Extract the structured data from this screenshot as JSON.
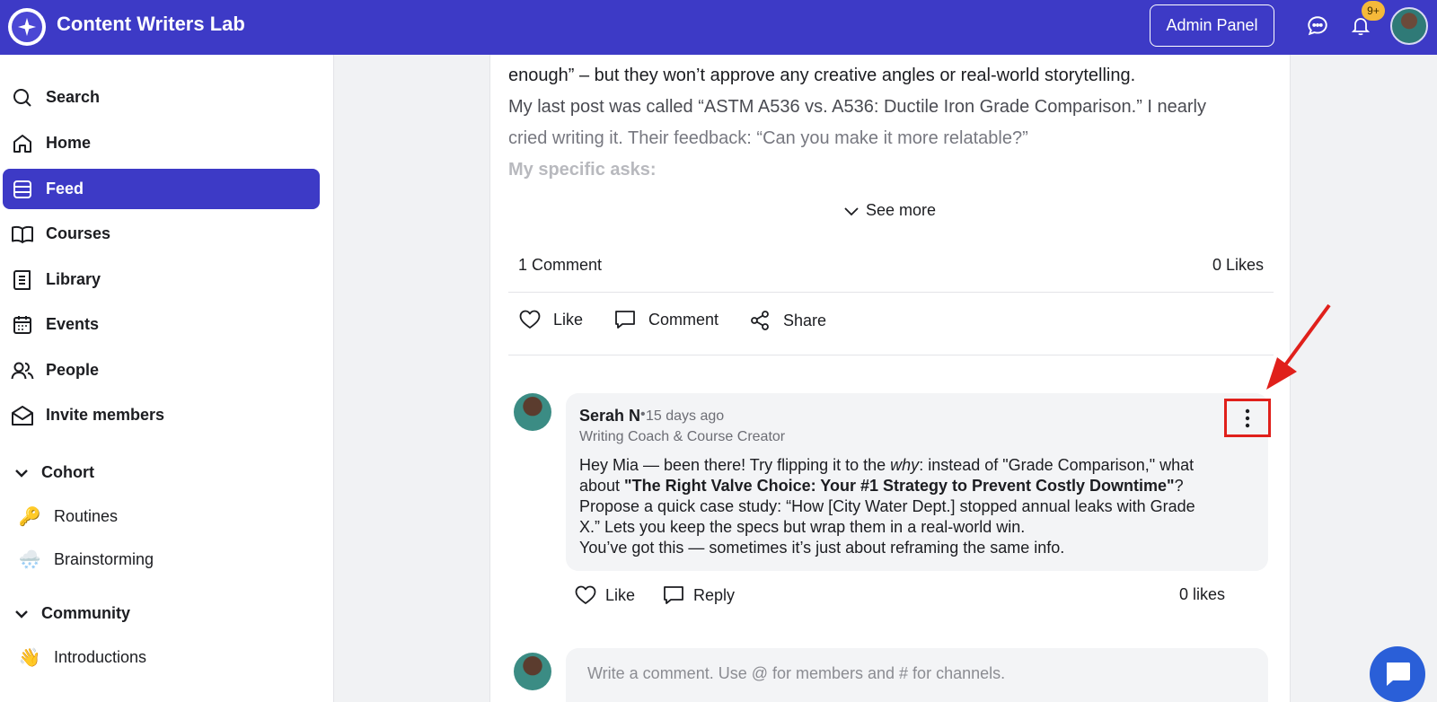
{
  "topbar": {
    "app_name": "Content Writers Lab",
    "admin_label": "Admin Panel",
    "notification_count": "9+",
    "icons": [
      "sparkle-logo-icon",
      "chat-bubble-icon",
      "bell-icon"
    ],
    "accent_color": "#3d3ac6"
  },
  "sidebar": {
    "items": [
      {
        "label": "Search",
        "icon": "search-icon"
      },
      {
        "label": "Home",
        "icon": "home-icon"
      },
      {
        "label": "Feed",
        "icon": "feed-icon",
        "active": true
      },
      {
        "label": "Courses",
        "icon": "book-open-icon"
      },
      {
        "label": "Library",
        "icon": "book-icon"
      },
      {
        "label": "Events",
        "icon": "calendar-icon"
      },
      {
        "label": "People",
        "icon": "people-icon"
      },
      {
        "label": "Invite members",
        "icon": "envelope-icon"
      }
    ],
    "sections": [
      {
        "label": "Cohort",
        "channels": [
          {
            "emoji": "🔑",
            "label": "Routines"
          },
          {
            "emoji": "🌨️",
            "label": "Brainstorming"
          }
        ]
      },
      {
        "label": "Community",
        "channels": [
          {
            "emoji": "👋",
            "label": "Introductions"
          }
        ]
      }
    ]
  },
  "post": {
    "lines": [
      "enough” – but they won’t approve any creative angles or real-world storytelling.",
      "My last post was called “ASTM A536 vs. A536: Ductile Iron Grade Comparison.” I nearly",
      "cried writing it. Their feedback: “Can you make it more relatable?”",
      "My specific asks:"
    ],
    "see_more": "See more",
    "comment_count": "1 Comment",
    "like_count": "0 Likes",
    "actions": {
      "like": "Like",
      "comment": "Comment",
      "share": "Share"
    }
  },
  "comment": {
    "author": "Serah N",
    "time": "15 days ago",
    "role": "Writing Coach & Course Creator",
    "body_1a": "Hey Mia — been there! Try flipping it to the ",
    "body_1em": "why",
    "body_1b": ": instead of \"Grade Comparison,\" what",
    "body_2a": "about ",
    "body_2bold": "\"The Right Valve Choice: Your #1 Strategy to Prevent Costly Downtime\"",
    "body_2b": "?",
    "body_3": "Propose a quick case study: “How [City Water Dept.] stopped annual leaks with Grade",
    "body_4": "X.” Lets you keep the specs but wrap them in a real-world win.",
    "body_5": "You’ve got this — sometimes it’s just about reframing the same info.",
    "like": "Like",
    "reply": "Reply",
    "likes": "0 likes"
  },
  "composer": {
    "placeholder": "Write a comment. Use @ for members and # for channels."
  }
}
